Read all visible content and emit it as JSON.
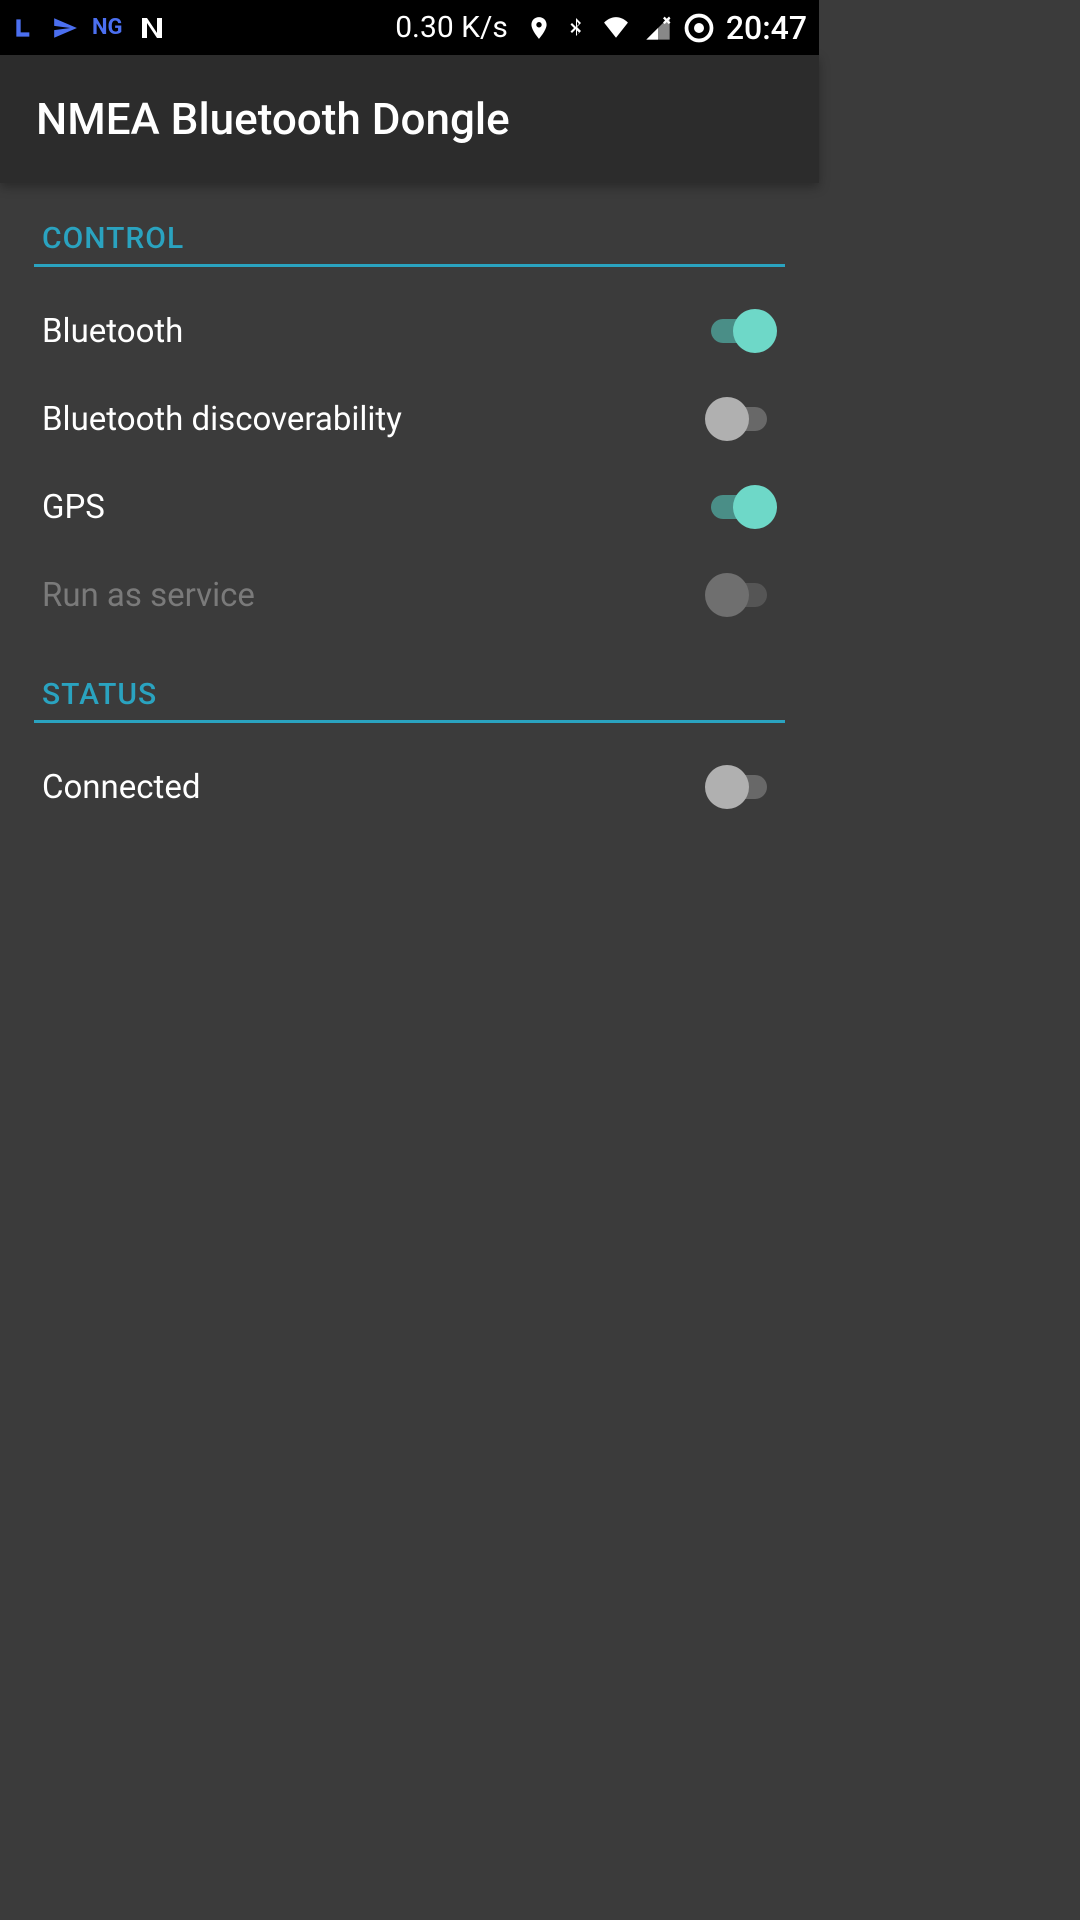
{
  "status_bar": {
    "ng_text": "NG",
    "net_speed": "0.30 K/s",
    "clock": "20:47"
  },
  "header": {
    "title": "NMEA Bluetooth Dongle"
  },
  "sections": {
    "control": {
      "title": "CONTROL",
      "items": [
        {
          "label": "Bluetooth",
          "on": true,
          "disabled": false
        },
        {
          "label": "Bluetooth discoverability",
          "on": false,
          "disabled": false
        },
        {
          "label": "GPS",
          "on": true,
          "disabled": false
        },
        {
          "label": "Run as service",
          "on": false,
          "disabled": true
        }
      ]
    },
    "status": {
      "title": "STATUS",
      "items": [
        {
          "label": "Connected",
          "on": false,
          "disabled": false
        }
      ]
    }
  }
}
